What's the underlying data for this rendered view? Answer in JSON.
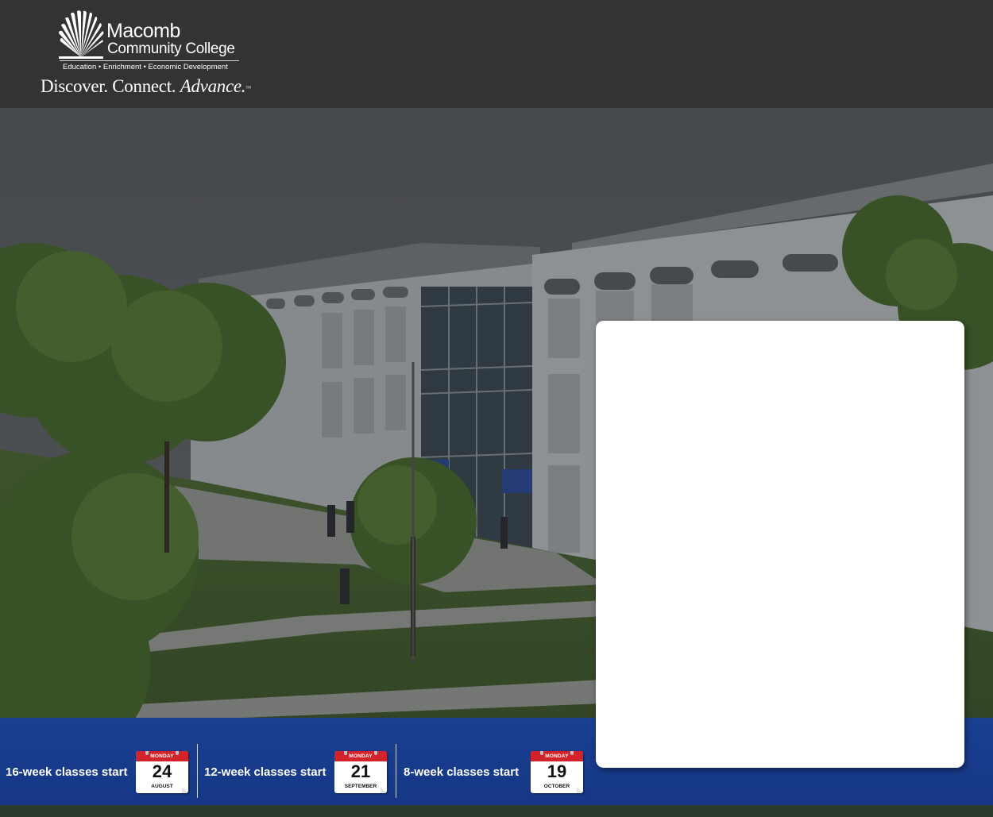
{
  "header": {
    "logo_name": "Macomb",
    "logo_sub": "Community College",
    "logo_tagline": "Education • Enrichment • Economic Development",
    "slogan_part1": "Discover. Connect.",
    "slogan_part2": "Advance.",
    "slogan_tm": "™"
  },
  "hero": {
    "image": "campus-building-photo"
  },
  "card": {},
  "class_starts": [
    {
      "label": "16-week classes start",
      "weekday": "MONDAY",
      "day": "24",
      "month": "AUGUST"
    },
    {
      "label": "12-week classes start",
      "weekday": "MONDAY",
      "day": "21",
      "month": "SEPTEMBER"
    },
    {
      "label": "8-week classes start",
      "weekday": "MONDAY",
      "day": "19",
      "month": "OCTOBER"
    }
  ],
  "colors": {
    "header_bg": "#323335",
    "band_blue": "#1a3f93",
    "calendar_red": "#d2232a"
  }
}
